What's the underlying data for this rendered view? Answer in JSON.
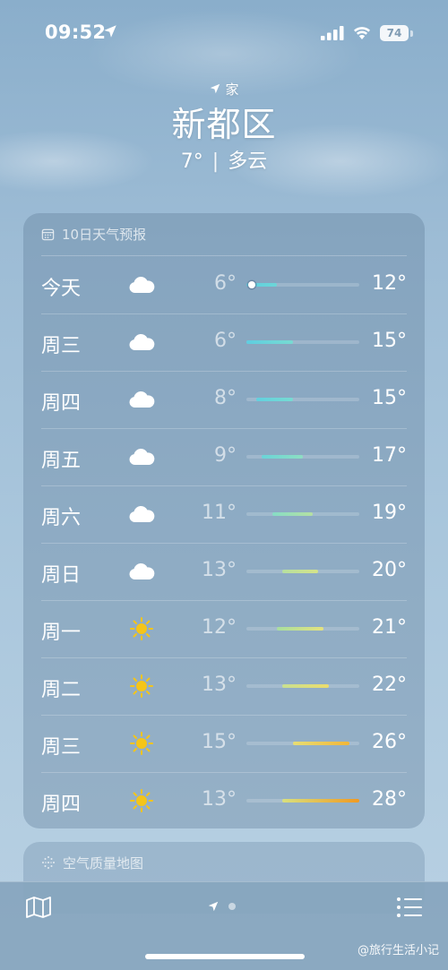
{
  "status": {
    "time": "09:52",
    "battery": "74"
  },
  "header": {
    "location_tag": "家",
    "city": "新都区",
    "current_temp": "7°",
    "separator": "|",
    "condition": "多云"
  },
  "forecast": {
    "title": "10日天气预报",
    "range_min": 6,
    "range_max": 28,
    "days": [
      {
        "day": "今天",
        "icon": "cloud-icon",
        "low": "6°",
        "high": "12°",
        "low_val": 6,
        "high_val": 12,
        "current": 7,
        "colors": [
          "#5fcde0",
          "#6cd6d8"
        ]
      },
      {
        "day": "周三",
        "icon": "cloud-icon",
        "low": "6°",
        "high": "15°",
        "low_val": 6,
        "high_val": 15,
        "colors": [
          "#5fcde0",
          "#77dbd2"
        ]
      },
      {
        "day": "周四",
        "icon": "cloud-icon",
        "low": "8°",
        "high": "15°",
        "low_val": 8,
        "high_val": 15,
        "colors": [
          "#62d0df",
          "#77dbd2"
        ]
      },
      {
        "day": "周五",
        "icon": "cloud-icon",
        "low": "9°",
        "high": "17°",
        "low_val": 9,
        "high_val": 17,
        "colors": [
          "#6ad4d8",
          "#8ddfc2"
        ]
      },
      {
        "day": "周六",
        "icon": "cloud-icon",
        "low": "11°",
        "high": "19°",
        "low_val": 11,
        "high_val": 19,
        "colors": [
          "#86dcc6",
          "#b5e0a2"
        ]
      },
      {
        "day": "周日",
        "icon": "cloud-icon",
        "low": "13°",
        "high": "20°",
        "low_val": 13,
        "high_val": 20,
        "colors": [
          "#b6e0a0",
          "#d5e389"
        ]
      },
      {
        "day": "周一",
        "icon": "sun-icon",
        "low": "12°",
        "high": "21°",
        "low_val": 12,
        "high_val": 21,
        "colors": [
          "#a8df9f",
          "#e4e27e"
        ]
      },
      {
        "day": "周二",
        "icon": "sun-icon",
        "low": "13°",
        "high": "22°",
        "low_val": 13,
        "high_val": 22,
        "colors": [
          "#c8e091",
          "#ecdc6c"
        ]
      },
      {
        "day": "周三",
        "icon": "sun-icon",
        "low": "15°",
        "high": "26°",
        "low_val": 15,
        "high_val": 26,
        "colors": [
          "#e7de74",
          "#f2b638"
        ]
      },
      {
        "day": "周四",
        "icon": "sun-icon",
        "low": "13°",
        "high": "28°",
        "low_val": 13,
        "high_val": 28,
        "colors": [
          "#d8e07e",
          "#f09a22"
        ]
      }
    ]
  },
  "air_quality": {
    "title": "空气质量地图"
  },
  "watermark": "@旅行生活小记",
  "colors": {
    "sun": "#f5c518",
    "cloud": "#ffffff"
  }
}
